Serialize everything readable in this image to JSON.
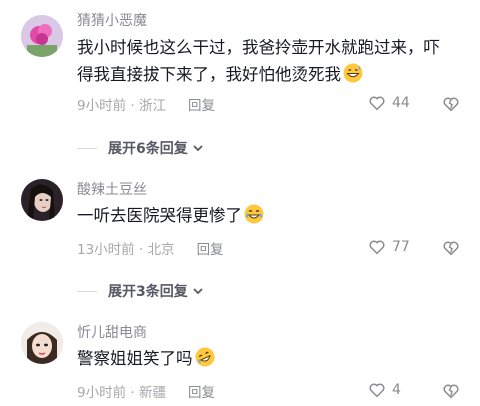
{
  "comments": [
    {
      "username": "猜猜小恶魔",
      "text": "我小时候也这么干过，我爸拎壶开水就跑过来，吓得我直接拔下来了，我好怕他烫死我",
      "emoji": "grin-sweat-emoji",
      "time": "9小时前",
      "location": "浙江",
      "reply_label": "回复",
      "likes": "44"
    },
    {
      "username": "酸辣土豆丝",
      "text": "一听去医院哭得更惨了",
      "emoji": "tears-of-joy-emoji",
      "time": "13小时前",
      "location": "北京",
      "reply_label": "回复",
      "likes": "77"
    },
    {
      "username": "忻儿甜电商",
      "text": "警察姐姐笑了吗",
      "emoji": "rofl-emoji",
      "time": "9小时前",
      "location": "新疆",
      "reply_label": "回复",
      "likes": "4"
    }
  ],
  "expanders": [
    {
      "label": "展开6条回复"
    },
    {
      "label": "展开3条回复"
    }
  ],
  "separator": " · ",
  "colors": {
    "text": "#161823",
    "meta": "#a6a7ad",
    "username": "#8a8b91",
    "emoji": "#ffc83d"
  }
}
